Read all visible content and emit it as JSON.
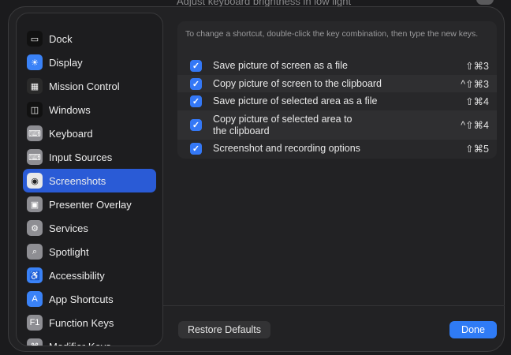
{
  "background": {
    "text": "Adjust keyboard brightness in low light"
  },
  "sidebar": {
    "items": [
      {
        "label": "Dock",
        "icon": "dock-icon",
        "glyph": "▭",
        "color": "#111111"
      },
      {
        "label": "Display",
        "icon": "display-icon",
        "glyph": "☀",
        "color": "#3a82f7"
      },
      {
        "label": "Mission Control",
        "icon": "mission-control-icon",
        "glyph": "▦",
        "color": "#2a2a2a"
      },
      {
        "label": "Windows",
        "icon": "windows-icon",
        "glyph": "◫",
        "color": "#111111"
      },
      {
        "label": "Keyboard",
        "icon": "keyboard-icon",
        "glyph": "⌨",
        "color": "#8e8e93"
      },
      {
        "label": "Input Sources",
        "icon": "keyboard-icon",
        "glyph": "⌨",
        "color": "#8e8e93"
      },
      {
        "label": "Screenshots",
        "icon": "camera-icon",
        "glyph": "◉",
        "color": "#e8e8e8",
        "selected": true
      },
      {
        "label": "Presenter Overlay",
        "icon": "person-icon",
        "glyph": "▣",
        "color": "#8e8e93"
      },
      {
        "label": "Services",
        "icon": "gears-icon",
        "glyph": "⚙",
        "color": "#8e8e93"
      },
      {
        "label": "Spotlight",
        "icon": "magnifier-icon",
        "glyph": "⌕",
        "color": "#8e8e93"
      },
      {
        "label": "Accessibility",
        "icon": "accessibility-icon",
        "glyph": "♿",
        "color": "#3a82f7"
      },
      {
        "label": "App Shortcuts",
        "icon": "app-store-icon",
        "glyph": "A",
        "color": "#3a82f7"
      },
      {
        "label": "Function Keys",
        "icon": "function-key-icon",
        "glyph": "F1",
        "color": "#8e8e93"
      },
      {
        "label": "Modifier Keys",
        "icon": "command-icon",
        "glyph": "⌘",
        "color": "#8e8e93"
      }
    ]
  },
  "panel": {
    "info": "To change a shortcut, double-click the key combination, then type the new keys.",
    "rows": [
      {
        "label": "Save picture of screen as a file",
        "shortcut": "⇧⌘3",
        "checked": true
      },
      {
        "label": "Copy picture of screen to the clipboard",
        "shortcut": "^⇧⌘3",
        "checked": true
      },
      {
        "label": "Save picture of selected area as a file",
        "shortcut": "⇧⌘4",
        "checked": true
      },
      {
        "label": "Copy picture of selected area to\nthe clipboard",
        "shortcut": "^⇧⌘4",
        "checked": true
      },
      {
        "label": "Screenshot and recording options",
        "shortcut": "⇧⌘5",
        "checked": true
      }
    ]
  },
  "buttons": {
    "restore": "Restore Defaults",
    "done": "Done"
  },
  "colors": {
    "accent": "#2f7bf5",
    "selection": "#2a5bd6"
  }
}
